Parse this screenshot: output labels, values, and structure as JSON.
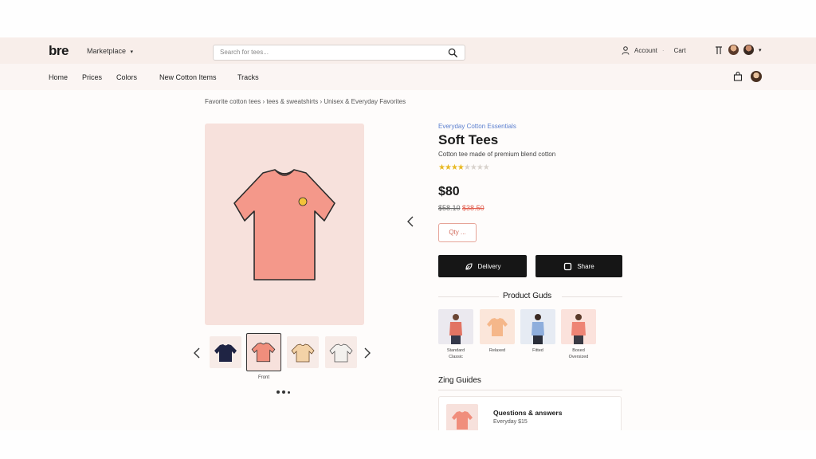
{
  "header": {
    "logo": "bre",
    "marketplace_label": "Marketplace",
    "search_placeholder": "Search for tees...",
    "account_label": "Account",
    "cart_label": "Cart"
  },
  "nav": {
    "items": [
      "Home",
      "Prices",
      "Colors",
      "New Cotton Items",
      "Tracks"
    ]
  },
  "breadcrumb": "Favorite cotton tees › tees & sweatshirts › Unisex & Everyday Favorites",
  "product": {
    "category": "Everyday Cotton Essentials",
    "title": "Soft Tees",
    "subtitle": "Cotton tee made of premium blend cotton",
    "rating": 4,
    "rating_max": 8,
    "price": "$80",
    "was_price": "$58.10",
    "sale_price": "$38.50",
    "size_button": "Qty ...",
    "buttons": [
      {
        "label": "Delivery",
        "icon": "leaf-icon"
      },
      {
        "label": "Share",
        "icon": "square-icon"
      }
    ]
  },
  "gallery": {
    "thumb_caption": "Front",
    "dots": 3,
    "thumbs": [
      {
        "color": "#1f2444"
      },
      {
        "color": "#f08e7c"
      },
      {
        "color": "#f3d2a7"
      },
      {
        "color": "#f3f1ee"
      }
    ]
  },
  "guides": {
    "title": "Product Guds",
    "items": [
      {
        "label_1": "Standard",
        "label_2": "Classic",
        "color": "#e27463",
        "bg": "#ebe9ef"
      },
      {
        "label_1": "Relaxed",
        "label_2": "",
        "color": "#f5b78a",
        "bg": "#fbe6da"
      },
      {
        "label_1": "Fitted",
        "label_2": "",
        "color": "#8eaedc",
        "bg": "#e6ebf3"
      },
      {
        "label_1": "Boxed",
        "label_2": "Oversized",
        "color": "#ee8475",
        "bg": "#fbe2dc"
      }
    ]
  },
  "size_guides": {
    "title": "Zing Guides",
    "card_title": "Questions & answers",
    "card_sub": "Everyday $15"
  },
  "colors": {
    "accent": "#5b7fcf",
    "sale": "#e05a4a",
    "tee": "#f4988a",
    "panel": "#f7e1dc"
  }
}
